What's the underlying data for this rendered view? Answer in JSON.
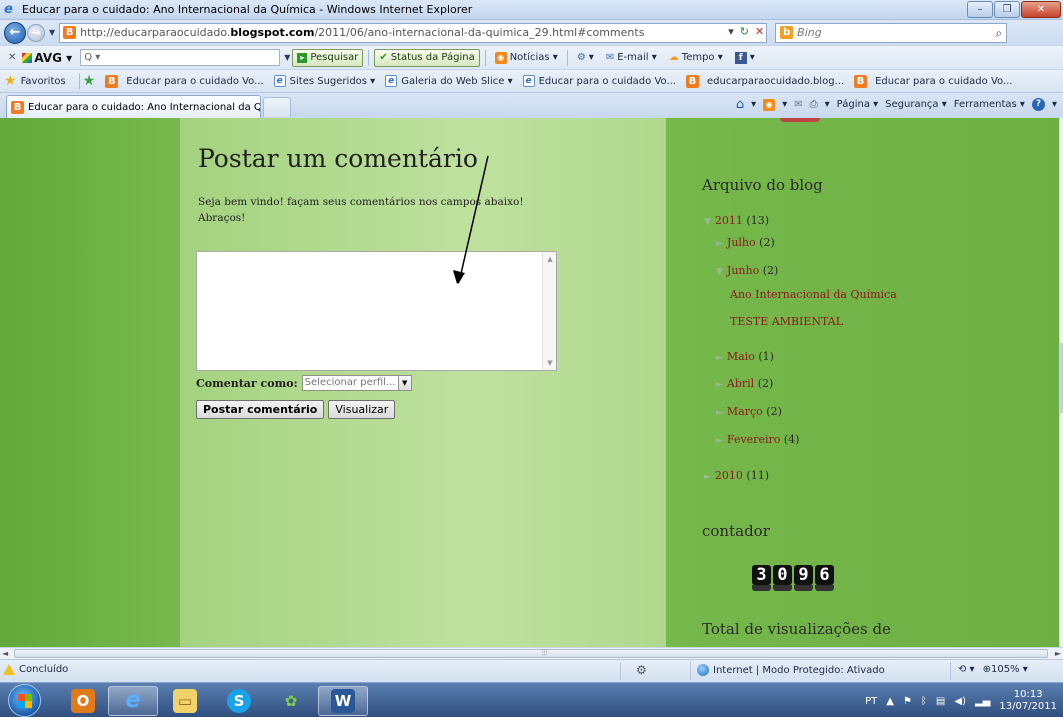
{
  "window": {
    "title": "Educar para o cuidado: Ano Internacional da Química - Windows Internet Explorer",
    "min_glyph": "–",
    "restore_glyph": "❐",
    "close_glyph": "✕"
  },
  "address": {
    "url_prefix": "http://educarparaocuidado.",
    "url_domain": "blogspot.com",
    "url_path": "/2011/06/ano-internacional-da-quimica_29.html#comments",
    "search_placeholder": "Bing"
  },
  "avg_toolbar": {
    "brand": "AVG",
    "search_prefix": "Q ▾",
    "pesquisar": "Pesquisar",
    "status": "Status da Página",
    "noticias": "Notícias ▾",
    "email": "E-mail ▾",
    "tempo": "Tempo ▾"
  },
  "favorites": {
    "label": "Favoritos",
    "items": [
      "Educar para o cuidado Vo...",
      "Sites Sugeridos ▾",
      "Galeria do Web Slice ▾",
      "Educar para o cuidado Vo...",
      "educarparaocuidado.blog...",
      "Educar para o cuidado Vo..."
    ]
  },
  "tabs": {
    "active_tab": "Educar para o cuidado: Ano Internacional da Quí...",
    "pagina": "Página ▾",
    "seguranca": "Segurança ▾",
    "ferramentas": "Ferramentas ▾"
  },
  "page": {
    "comment_title": "Postar um comentário",
    "welcome_line1": "Seja bem vindo! façam seus comentários nos campos abaixo!",
    "welcome_line2": "Abraços!",
    "comment_as_label": "Comentar como:",
    "profile_placeholder": "Selecionar perfil...",
    "post_button": "Postar comentário",
    "preview_button": "Visualizar"
  },
  "sidebar": {
    "archive_title": "Arquivo do blog",
    "year_2011": "2011",
    "year_2011_count": "(13)",
    "months_2011": [
      {
        "name": "Julho",
        "count": "(2)",
        "expanded": false
      },
      {
        "name": "Junho",
        "count": "(2)",
        "expanded": true
      },
      {
        "name": "Maio",
        "count": "(1)",
        "expanded": false
      },
      {
        "name": "Abril",
        "count": "(2)",
        "expanded": false
      },
      {
        "name": "Março",
        "count": "(2)",
        "expanded": false
      },
      {
        "name": "Fevereiro",
        "count": "(4)",
        "expanded": false
      }
    ],
    "june_posts": [
      "Ano Internacional da Química",
      "TESTE AMBIENTAL"
    ],
    "year_2010": "2010",
    "year_2010_count": "(11)",
    "counter_title": "contador",
    "counter_digits": [
      "3",
      "0",
      "9",
      "6"
    ],
    "total_views_title": "Total de visualizações de"
  },
  "status": {
    "text": "Concluído",
    "zone": "Internet | Modo Protegido: Ativado",
    "zoom": "105%"
  },
  "taskbar": {
    "lang": "PT",
    "time": "10:13",
    "date": "13/07/2011"
  },
  "colors": {
    "link": "#8b1a1a",
    "page_green": "#6fb345",
    "main_green": "#bfe19f"
  }
}
